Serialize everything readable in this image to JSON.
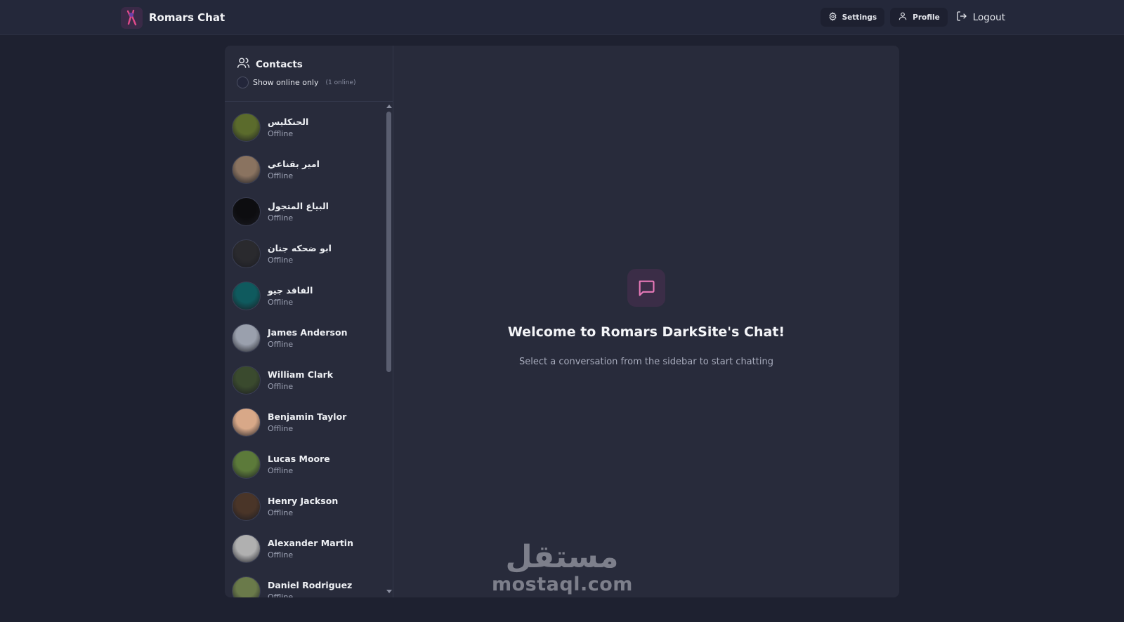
{
  "app": {
    "name": "Romars Chat"
  },
  "nav": {
    "settings": "Settings",
    "profile": "Profile",
    "logout": "Logout"
  },
  "contacts": {
    "title": "Contacts",
    "filter_label": "Show online only",
    "online_count": "(1 online)",
    "items": [
      {
        "name": "الحنكليس",
        "status": "Offline",
        "avatar_color": "#5b6b2c"
      },
      {
        "name": "امير بقناعي",
        "status": "Offline",
        "avatar_color": "#8a7360"
      },
      {
        "name": "البياع المتجول",
        "status": "Offline",
        "avatar_color": "#0d0d10"
      },
      {
        "name": "ابو ضحكه جنان",
        "status": "Offline",
        "avatar_color": "#2a2a2e"
      },
      {
        "name": "الفاقد جيو",
        "status": "Offline",
        "avatar_color": "#0f5a5e"
      },
      {
        "name": "James Anderson",
        "status": "Offline",
        "avatar_color": "#9aa0ad"
      },
      {
        "name": "William Clark",
        "status": "Offline",
        "avatar_color": "#3a4a2e"
      },
      {
        "name": "Benjamin Taylor",
        "status": "Offline",
        "avatar_color": "#d8a888"
      },
      {
        "name": "Lucas Moore",
        "status": "Offline",
        "avatar_color": "#5c7a3a"
      },
      {
        "name": "Henry Jackson",
        "status": "Offline",
        "avatar_color": "#4a3528"
      },
      {
        "name": "Alexander Martin",
        "status": "Offline",
        "avatar_color": "#b0b0b0"
      },
      {
        "name": "Daniel Rodriguez",
        "status": "Offline",
        "avatar_color": "#6a7a4a"
      }
    ]
  },
  "welcome": {
    "title": "Welcome to Romars DarkSite's Chat!",
    "subtitle": "Select a conversation from the sidebar to start chatting"
  },
  "watermark": {
    "arabic": "مستقل",
    "latin": "mostaql.com"
  },
  "colors": {
    "background": "#1e2130",
    "panel": "#282b3b",
    "accent": "#e879b9"
  }
}
